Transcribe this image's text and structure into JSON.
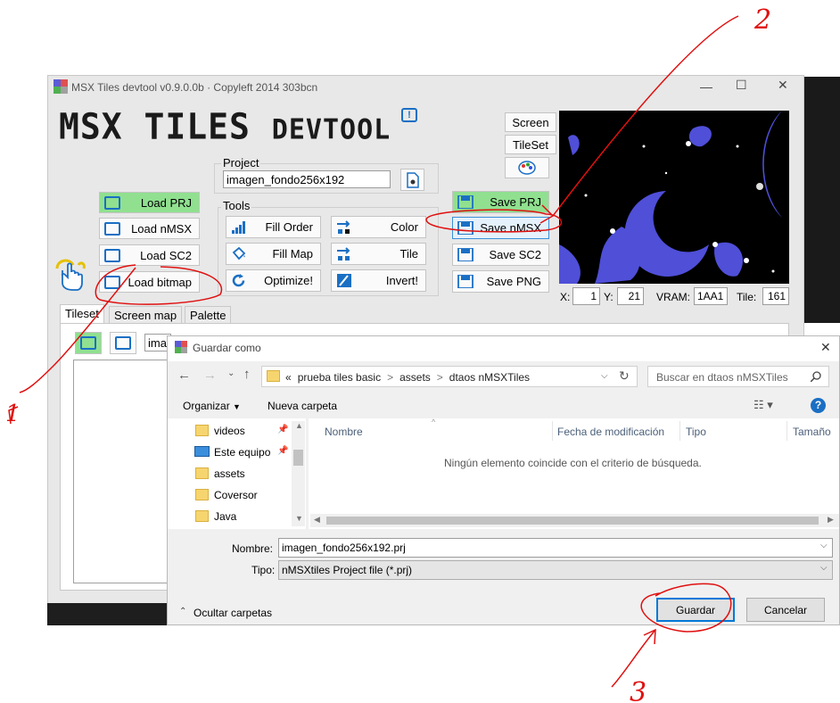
{
  "app": {
    "title": "MSX Tiles devtool v0.9.0.0b · Copyleft 2014 303bcn",
    "logo_main": "MSX TILES",
    "logo_sub": "DEVTOOL",
    "screen_btn": "Screen",
    "tileset_btn": "TileSet",
    "project_label": "Project",
    "project_name": "imagen_fondo256x192",
    "tools_label": "Tools",
    "load_buttons": [
      "Load PRJ",
      "Load nMSX",
      "Load SC2",
      "Load bitmap"
    ],
    "tool_buttons": [
      "Fill Order",
      "Color",
      "Fill Map",
      "Tile",
      "Optimize!",
      "Invert!"
    ],
    "save_buttons": [
      "Save PRJ",
      "Save nMSX",
      "Save SC2",
      "Save PNG"
    ],
    "status": {
      "x_label": "X:",
      "x_value": "1",
      "y_label": "Y:",
      "y_value": "21",
      "vram_label": "VRAM:",
      "vram_value": "1AA1",
      "tile_label": "Tile:",
      "tile_value": "161"
    },
    "tabs": [
      "Tileset",
      "Screen map",
      "Palette"
    ],
    "tileset_field": "ima"
  },
  "dialog": {
    "title": "Guardar como",
    "close": "✕",
    "path": [
      "«",
      "prueba tiles basic",
      ">",
      "assets",
      ">",
      "dtaos nMSXTiles"
    ],
    "search_placeholder": "Buscar en dtaos nMSXTiles",
    "organize": "Organizar",
    "new_folder": "Nueva carpeta",
    "nav_items": [
      "videos",
      "Este equipo",
      "assets",
      "Coversor",
      "Java"
    ],
    "columns": [
      "Nombre",
      "Fecha de modificación",
      "Tipo",
      "Tamaño"
    ],
    "empty_message": "Ningún elemento coincide con el criterio de búsqueda.",
    "name_label": "Nombre:",
    "name_value": "imagen_fondo256x192.prj",
    "type_label": "Tipo:",
    "type_value": "nMSXtiles Project file (*.prj)",
    "hide_folders": "Ocultar carpetas",
    "save": "Guardar",
    "cancel": "Cancelar"
  },
  "annotations": [
    "1",
    "2",
    "3"
  ],
  "colors": {
    "green_button": "#90e090",
    "annotation": "#e01010",
    "preview_blue": "#4f4fd8"
  }
}
